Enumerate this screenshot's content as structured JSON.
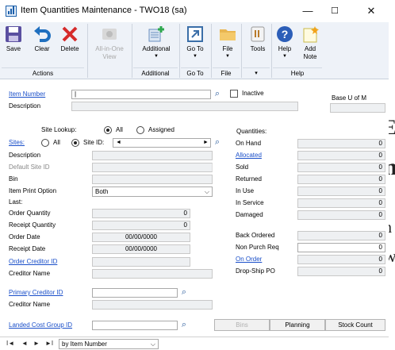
{
  "window": {
    "title": "Item Quantities Maintenance  -  TWO18 (sa)",
    "minimize": "—",
    "maximize": "☐",
    "close": "✕"
  },
  "ribbon": {
    "save": "Save",
    "clear": "Clear",
    "delete": "Delete",
    "all_in_one_1": "All-in-One",
    "all_in_one_2": "View",
    "additional": "Additional",
    "goto": "Go To",
    "file": "File",
    "tools": "Tools",
    "help": "Help",
    "add_note_1": "Add",
    "add_note_2": "Note",
    "groups": {
      "actions": "Actions",
      "additional": "Additional",
      "goto": "Go To",
      "file": "File",
      "tools": "▾",
      "help": "Help"
    }
  },
  "form": {
    "item_number_label": "Item Number",
    "item_number_value": "|",
    "inactive_label": "Inactive",
    "description_label": "Description",
    "base_uom_label": "Base U of M",
    "site_lookup_label": "Site Lookup:",
    "all_label": "All",
    "assigned_label": "Assigned",
    "sites_label": "Sites:",
    "site_all_label": "All",
    "site_id_label": "Site ID:",
    "site_description_label": "Description",
    "default_site_label": "Default Site ID",
    "bin_label": "Bin",
    "print_option_label": "Item Print Option",
    "print_option_value": "Both",
    "last_label": "Last:",
    "order_qty_label": "Order Quantity",
    "order_qty_value": "0",
    "receipt_qty_label": "Receipt Quantity",
    "receipt_qty_value": "0",
    "order_date_label": "Order Date",
    "order_date_value": "00/00/0000",
    "receipt_date_label": "Receipt Date",
    "receipt_date_value": "00/00/0000",
    "order_creditor_label": "Order Creditor ID",
    "creditor_name_label": "Creditor Name",
    "primary_creditor_label": "Primary Creditor ID",
    "creditor_name2_label": "Creditor Name",
    "landed_cost_label": "Landed Cost Group ID"
  },
  "quantities": {
    "heading": "Quantities:",
    "rows": [
      {
        "label": "On Hand",
        "value": "0"
      },
      {
        "label": "Allocated",
        "value": "0"
      },
      {
        "label": "Sold",
        "value": "0"
      },
      {
        "label": "Returned",
        "value": "0"
      },
      {
        "label": "In Use",
        "value": "0"
      },
      {
        "label": "In Service",
        "value": "0"
      },
      {
        "label": "Damaged",
        "value": "0"
      }
    ],
    "rows2": [
      {
        "label": "Back Ordered",
        "value": "0"
      },
      {
        "label": "Non Purch Req",
        "value": "0"
      },
      {
        "label": "On Order",
        "value": "0"
      },
      {
        "label": "Drop-Ship PO",
        "value": "0"
      }
    ]
  },
  "buttons": {
    "bins": "Bins",
    "planning": "Planning",
    "stock_count": "Stock Count"
  },
  "statusbar": {
    "first": "I◄",
    "prev": "◄",
    "next": "►",
    "last": "►I",
    "sort": "by Item Number"
  },
  "colors": {
    "link": "#1a4fc9",
    "ribbon_bg": "#eef2f8",
    "save_blue": "#5a4fa0",
    "clear_blue": "#1f6fbf",
    "delete_red": "#d62b2b"
  }
}
